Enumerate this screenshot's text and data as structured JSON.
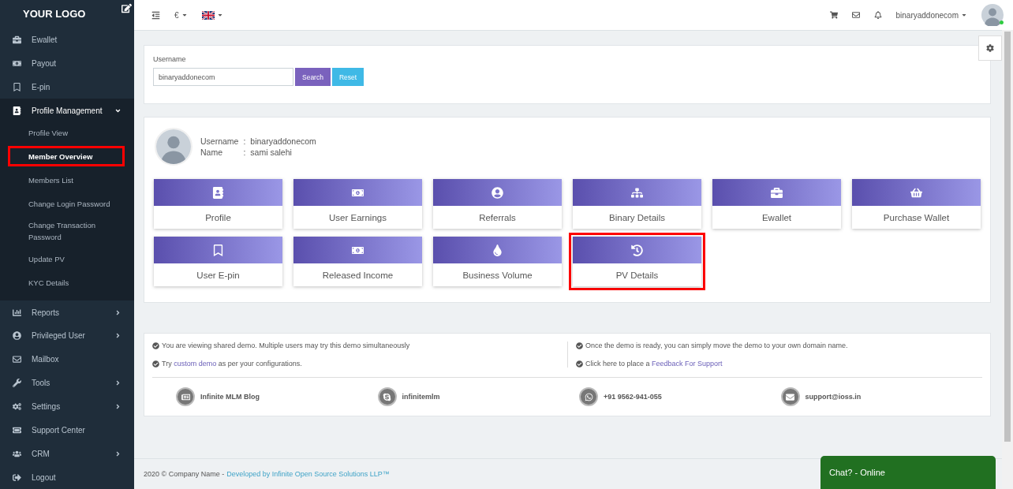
{
  "sidebar": {
    "logo": "YOUR LOGO",
    "items": [
      {
        "label": "Ewallet",
        "has_arrow": false,
        "expanded": false
      },
      {
        "label": "Payout",
        "has_arrow": false,
        "expanded": false
      },
      {
        "label": "E-pin",
        "has_arrow": false,
        "expanded": false
      },
      {
        "label": "Profile Management",
        "has_arrow": true,
        "expanded": true,
        "children": [
          {
            "label": "Profile View",
            "selected": false,
            "highlighted": false
          },
          {
            "label": "Member Overview",
            "selected": true,
            "highlighted": true
          },
          {
            "label": "Members List",
            "selected": false,
            "highlighted": false
          },
          {
            "label": "Change Login Password",
            "selected": false,
            "highlighted": false
          },
          {
            "label": "Change Transaction Password",
            "selected": false,
            "highlighted": false
          },
          {
            "label": "Update PV",
            "selected": false,
            "highlighted": false
          },
          {
            "label": "KYC Details",
            "selected": false,
            "highlighted": false
          }
        ]
      },
      {
        "label": "Reports",
        "has_arrow": true,
        "expanded": false
      },
      {
        "label": "Privileged User",
        "has_arrow": true,
        "expanded": false
      },
      {
        "label": "Mailbox",
        "has_arrow": false,
        "expanded": false
      },
      {
        "label": "Tools",
        "has_arrow": true,
        "expanded": false
      },
      {
        "label": "Settings",
        "has_arrow": true,
        "expanded": false
      },
      {
        "label": "Support Center",
        "has_arrow": false,
        "expanded": false
      },
      {
        "label": "CRM",
        "has_arrow": true,
        "expanded": false
      },
      {
        "label": "Logout",
        "has_arrow": false,
        "expanded": false
      }
    ]
  },
  "header": {
    "currency": "€",
    "username": "binaryaddonecom",
    "online": true
  },
  "search": {
    "label": "Username",
    "value": "binaryaddonecom",
    "buttons": [
      "Search",
      "Reset"
    ]
  },
  "profile": {
    "username_label": "Username",
    "username_sep": ":",
    "username": "binaryaddonecom",
    "name_label": "Name",
    "name_sep": ":",
    "name": "sami salehi"
  },
  "tiles": [
    {
      "label": "Profile",
      "highlighted": false
    },
    {
      "label": "User Earnings",
      "highlighted": false
    },
    {
      "label": "Referrals",
      "highlighted": false
    },
    {
      "label": "Binary Details",
      "highlighted": false
    },
    {
      "label": "Ewallet",
      "highlighted": false
    },
    {
      "label": "Purchase Wallet",
      "highlighted": false
    },
    {
      "label": "User E-pin",
      "highlighted": false
    },
    {
      "label": "Released Income",
      "highlighted": false
    },
    {
      "label": "Business Volume",
      "highlighted": false
    },
    {
      "label": "PV Details",
      "highlighted": true
    }
  ],
  "notices": [
    {
      "before": "You are viewing shared demo. Multiple users may try this demo simultaneously"
    },
    {
      "before": "Try",
      "link": "custom demo",
      "after": "as per your configurations."
    },
    {
      "before": "Once the demo is ready, you can simply move the demo to your own domain name."
    },
    {
      "before": "Click here to place a",
      "link": "Feedback For Support"
    }
  ],
  "contacts": [
    "Infinite MLM Blog",
    "infinitemlm",
    "+91 9562-941-055",
    "support@ioss.in"
  ],
  "footer": {
    "text": "2020 © Company Name -",
    "link": "Developed by Infinite Open Source Solutions LLP™"
  },
  "chat": {
    "label": "Chat? - Online"
  }
}
